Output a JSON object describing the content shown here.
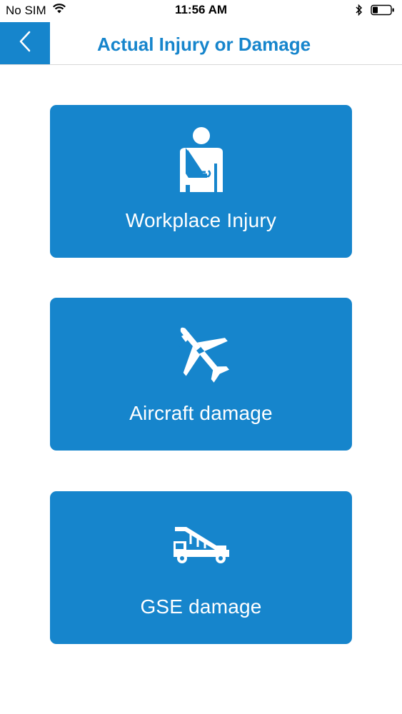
{
  "status_bar": {
    "carrier": "No SIM",
    "time": "11:56 AM"
  },
  "nav": {
    "title": "Actual Injury or Damage",
    "back_icon": "chevron-left-icon"
  },
  "options": [
    {
      "label": "Workplace Injury",
      "icon": "injured-person-icon"
    },
    {
      "label": "Aircraft damage",
      "icon": "broken-airplane-icon"
    },
    {
      "label": "GSE damage",
      "icon": "stair-truck-icon"
    }
  ],
  "colors": {
    "accent": "#1685cc",
    "background": "#ffffff",
    "card_text": "#ffffff"
  }
}
